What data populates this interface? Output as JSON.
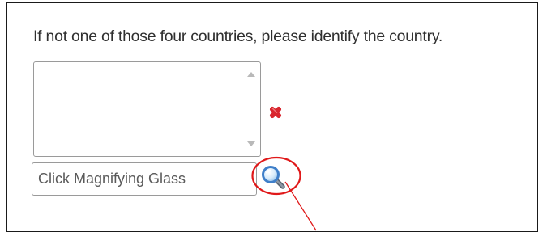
{
  "form": {
    "question": "If not one of those four countries, please identify the country.",
    "country_textarea": {
      "value": "",
      "scroll_up_icon": "triangle-up-icon",
      "scroll_down_icon": "triangle-down-icon"
    },
    "required_icon": "red-x-icon",
    "lookup": {
      "placeholder": "Click Magnifying Glass",
      "value": "",
      "button_icon": "magnifying-glass-icon"
    }
  },
  "annotation": {
    "shape": "circle",
    "target": "magnifying-glass-button",
    "color": "#e0191a"
  },
  "colors": {
    "panel_border": "#1a1a1a",
    "field_border": "#9a9a9a",
    "required_mark": "#d9262e",
    "magnifier_blue": "#3f7fc9"
  }
}
